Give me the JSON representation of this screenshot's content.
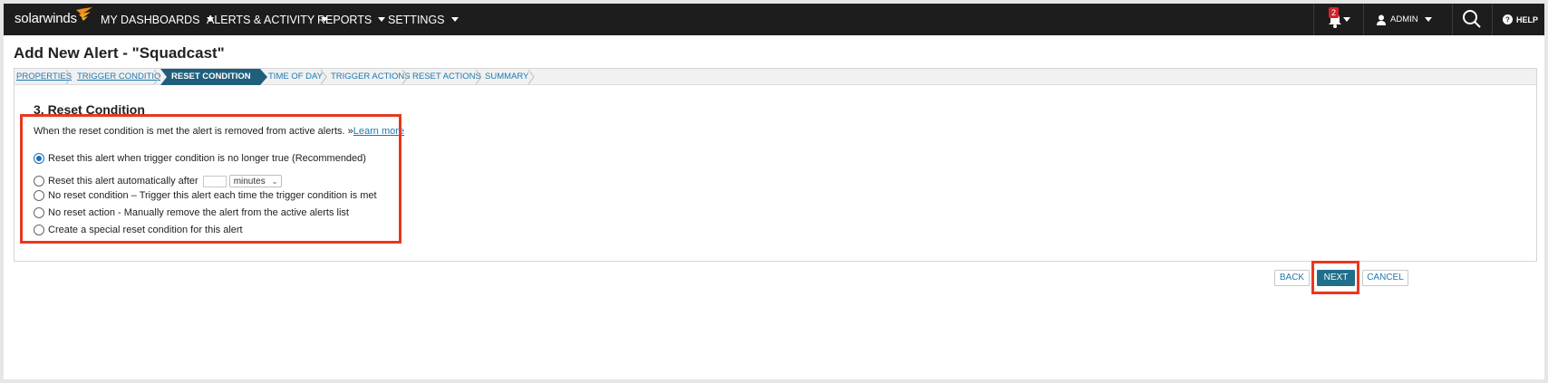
{
  "nav": {
    "logo": "solarwinds",
    "menu": [
      {
        "label": "MY DASHBOARDS"
      },
      {
        "label": "ALERTS & ACTIVITY"
      },
      {
        "label": "REPORTS"
      },
      {
        "label": "SETTINGS"
      }
    ],
    "notification_count": "2",
    "user_label": "ADMIN",
    "help_label": "HELP"
  },
  "page": {
    "title": "Add New Alert - \"Squadcast\""
  },
  "wizard": {
    "steps": [
      {
        "label": "PROPERTIES"
      },
      {
        "label": "TRIGGER CONDITION"
      },
      {
        "label": "RESET CONDITION"
      },
      {
        "label": "TIME OF DAY"
      },
      {
        "label": "TRIGGER ACTIONS"
      },
      {
        "label": "RESET ACTIONS"
      },
      {
        "label": "SUMMARY"
      }
    ],
    "active_step": "RESET CONDITION"
  },
  "reset_condition": {
    "heading": "3. Reset Condition",
    "description": "When the reset condition is met the alert is removed from active alerts. »",
    "learn_more": "Learn more",
    "options": [
      {
        "label": "Reset this alert when trigger condition is no longer true (Recommended)",
        "selected": true
      },
      {
        "label": "Reset this alert automatically after",
        "selected": false
      },
      {
        "label": "No reset condition – Trigger this alert each time the trigger condition is met",
        "selected": false
      },
      {
        "label": "No reset action - Manually remove the alert from the active alerts list",
        "selected": false
      },
      {
        "label": "Create a special reset condition for this alert",
        "selected": false
      }
    ],
    "auto_reset_value": "",
    "auto_reset_unit": "minutes"
  },
  "buttons": {
    "back": "BACK",
    "next": "NEXT",
    "cancel": "CANCEL"
  },
  "colors": {
    "nav_bg": "#1d1d1d",
    "active_step": "#1f5f7c",
    "primary_button": "#1f6f8b",
    "highlight_border": "#e8391f",
    "link": "#1c7ab4"
  },
  "icons": [
    "solarwinds-flame-icon",
    "caret-down-icon",
    "bell-icon",
    "user-icon",
    "search-icon",
    "help-icon",
    "chevron-right-icon",
    "chevron-down-icon"
  ]
}
